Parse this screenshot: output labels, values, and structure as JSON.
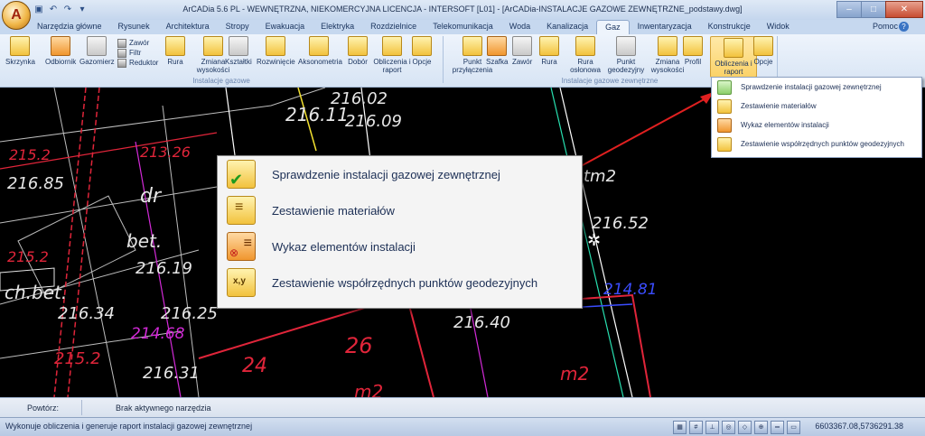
{
  "app": {
    "logo_letter": "A",
    "title": "ArCADia 5.6 PL - WEWNĘTRZNA, NIEKOMERCYJNA LICENCJA - INTERSOFT [L01] - [ArCADia-INSTALACJE GAZOWE ZEWNĘTRZNE_podstawy.dwg]"
  },
  "tabs": [
    "Narzędzia główne",
    "Rysunek",
    "Architektura",
    "Stropy",
    "Ewakuacja",
    "Elektryka",
    "Rozdzielnice",
    "Telekomunikacja",
    "Woda",
    "Kanalizacja",
    "Gaz",
    "Inwentaryzacja",
    "Konstrukcje",
    "Widok"
  ],
  "active_tab": "Gaz",
  "help_label": "Pomoc",
  "ribbon": {
    "group1_label": "Instalacje gazowe",
    "group2_label": "Instalacje gazowe zewnętrzne",
    "small_items": [
      "Zawór",
      "Filtr",
      "Reduktor"
    ],
    "buttons1": [
      {
        "label": "Skrzynka",
        "icon": "box-icon"
      },
      {
        "label": "Odbiornik",
        "icon": "receiver-icon"
      },
      {
        "label": "Gazomierz",
        "icon": "gas-meter-icon"
      },
      {
        "label": "Rura",
        "icon": "pipe-icon"
      },
      {
        "label": "Zmiana wysokości",
        "icon": "height-change-icon"
      },
      {
        "label": "Kształtki",
        "icon": "fittings-icon"
      },
      {
        "label": "Rozwinięcie",
        "icon": "unfold-icon"
      },
      {
        "label": "Aksonometria",
        "icon": "axonometry-icon"
      },
      {
        "label": "Dobór",
        "icon": "selection-icon"
      },
      {
        "label": "Obliczenia i raport",
        "icon": "calc-report-icon"
      },
      {
        "label": "Opcje",
        "icon": "options-icon"
      }
    ],
    "buttons2": [
      {
        "label": "Punkt przyłączenia",
        "icon": "connection-point-icon"
      },
      {
        "label": "Szafka",
        "icon": "cabinet-icon"
      },
      {
        "label": "Zawór",
        "icon": "valve-icon"
      },
      {
        "label": "Rura",
        "icon": "pipe-icon"
      },
      {
        "label": "Rura osłonowa",
        "icon": "casing-pipe-icon"
      },
      {
        "label": "Punkt geodezyjny",
        "icon": "geodetic-point-icon"
      },
      {
        "label": "Zmiana wysokości",
        "icon": "height-change-icon"
      },
      {
        "label": "Profil",
        "icon": "profile-icon"
      },
      {
        "label": "Obliczenia i raport",
        "icon": "calc-report-icon"
      },
      {
        "label": "Opcje",
        "icon": "options-icon"
      }
    ]
  },
  "menu_items": [
    "Sprawdzenie instalacji gazowej zewnętrznej",
    "Zestawienie materiałów",
    "Wykaz elementów instalacji",
    "Zestawienie współrzędnych punktów geodezyjnych"
  ],
  "cad_labels": {
    "white": [
      "216.11",
      "216.02",
      "216.09",
      "216.85",
      "dr",
      "bet.",
      "216.19",
      "216.25",
      "216.34",
      "216.31",
      "216.40",
      "216.52",
      "tm2",
      "ch.bet."
    ],
    "red": [
      "215.2",
      "213.26",
      "215.2",
      "215.2",
      "26",
      "24",
      "m2",
      "m2"
    ],
    "magenta": [
      "214.68"
    ],
    "blue": [
      "214.81"
    ]
  },
  "cmd": {
    "prompt_label": "Powtórz:",
    "status": "Brak aktywnego narzędzia"
  },
  "status_text": "Wykonuje obliczenia i generuje raport instalacji gazowej zewnętrznej",
  "coords": "6603367.08,5736291.38",
  "colors": {
    "accent": "#fbd268",
    "arrow": "#e02020",
    "cad_red": "#e0253a",
    "cad_magenta": "#d32ad8",
    "cad_blue": "#3b4dff"
  }
}
